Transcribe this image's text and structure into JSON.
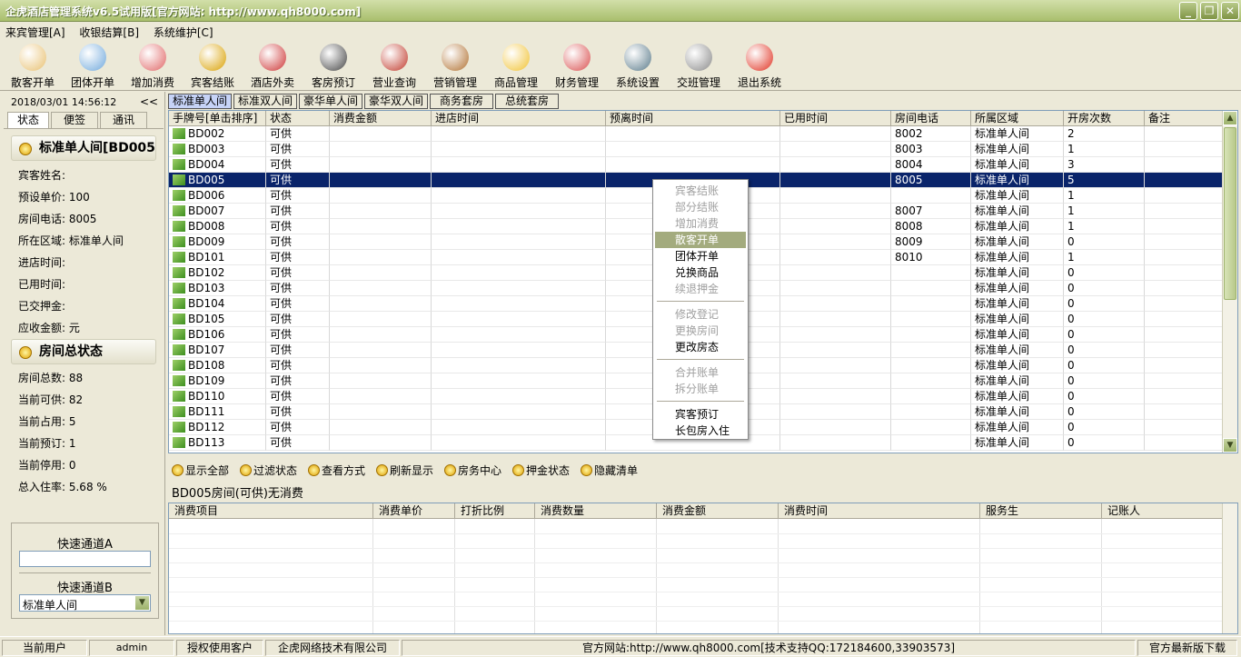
{
  "window": {
    "title": "企虎酒店管理系统v6.5试用版[官方网站: http://www.qh8000.com]"
  },
  "menu": [
    "来宾管理[A]",
    "收银结算[B]",
    "系统维护[C]"
  ],
  "toolbar": [
    {
      "label": "散客开单",
      "color": "#e8c070"
    },
    {
      "label": "团体开单",
      "color": "#6fa8dc"
    },
    {
      "label": "增加消费",
      "color": "#e06666"
    },
    {
      "label": "宾客结账",
      "color": "#d9a000"
    },
    {
      "label": "酒店外卖",
      "color": "#cc3333"
    },
    {
      "label": "客房预订",
      "color": "#444444"
    },
    {
      "label": "营业查询",
      "color": "#c0392b"
    },
    {
      "label": "营销管理",
      "color": "#b07030"
    },
    {
      "label": "商品管理",
      "color": "#f1c232"
    },
    {
      "label": "财务管理",
      "color": "#d94f4f"
    },
    {
      "label": "系统设置",
      "color": "#5a7a8a"
    },
    {
      "label": "交班管理",
      "color": "#8a8a8a"
    },
    {
      "label": "退出系统",
      "color": "#e03020"
    }
  ],
  "left": {
    "datetime": "2018/03/01 14:56:12",
    "collapse": "<<",
    "tabs": [
      "状态",
      "便签",
      "通讯"
    ],
    "room_title": "标准单人间[BD005",
    "fields": [
      "宾客姓名:",
      "预设单价: 100",
      "房间电话: 8005",
      "所在区域: 标准单人间",
      "进店时间:",
      "已用时间:",
      "已交押金:",
      "应收金额: 元"
    ],
    "status_title": "房间总状态",
    "stats": [
      "房间总数: 88",
      "当前可供: 82",
      "当前占用: 5",
      "当前预订: 1",
      "当前停用: 0",
      "总入住率: 5.68 %"
    ],
    "quick_a": "快速通道A",
    "quick_b": "快速通道B",
    "quick_b_value": "标准单人间"
  },
  "room_tabs": [
    "标准单人间",
    "标准双人间",
    "豪华单人间",
    "豪华双人间",
    "商务套房",
    "总统套房"
  ],
  "grid": {
    "headers": [
      "手牌号[单击排序]",
      "状态",
      "消费金额",
      "进店时间",
      "预离时间",
      "已用时间",
      "房间电话",
      "所属区域",
      "开房次数",
      "备注"
    ],
    "rows": [
      [
        "BD002",
        "可供",
        "",
        "",
        "",
        "",
        "8002",
        "标准单人间",
        "2",
        ""
      ],
      [
        "BD003",
        "可供",
        "",
        "",
        "",
        "",
        "8003",
        "标准单人间",
        "1",
        ""
      ],
      [
        "BD004",
        "可供",
        "",
        "",
        "",
        "",
        "8004",
        "标准单人间",
        "3",
        ""
      ],
      [
        "BD005",
        "可供",
        "",
        "",
        "",
        "",
        "8005",
        "标准单人间",
        "5",
        ""
      ],
      [
        "BD006",
        "可供",
        "",
        "",
        "",
        "",
        "",
        "标准单人间",
        "1",
        ""
      ],
      [
        "BD007",
        "可供",
        "",
        "",
        "",
        "",
        "8007",
        "标准单人间",
        "1",
        ""
      ],
      [
        "BD008",
        "可供",
        "",
        "",
        "",
        "",
        "8008",
        "标准单人间",
        "1",
        ""
      ],
      [
        "BD009",
        "可供",
        "",
        "",
        "",
        "",
        "8009",
        "标准单人间",
        "0",
        ""
      ],
      [
        "BD101",
        "可供",
        "",
        "",
        "",
        "",
        "8010",
        "标准单人间",
        "1",
        ""
      ],
      [
        "BD102",
        "可供",
        "",
        "",
        "",
        "",
        "",
        "标准单人间",
        "0",
        ""
      ],
      [
        "BD103",
        "可供",
        "",
        "",
        "",
        "",
        "",
        "标准单人间",
        "0",
        ""
      ],
      [
        "BD104",
        "可供",
        "",
        "",
        "",
        "",
        "",
        "标准单人间",
        "0",
        ""
      ],
      [
        "BD105",
        "可供",
        "",
        "",
        "",
        "",
        "",
        "标准单人间",
        "0",
        ""
      ],
      [
        "BD106",
        "可供",
        "",
        "",
        "",
        "",
        "",
        "标准单人间",
        "0",
        ""
      ],
      [
        "BD107",
        "可供",
        "",
        "",
        "",
        "",
        "",
        "标准单人间",
        "0",
        ""
      ],
      [
        "BD108",
        "可供",
        "",
        "",
        "",
        "",
        "",
        "标准单人间",
        "0",
        ""
      ],
      [
        "BD109",
        "可供",
        "",
        "",
        "",
        "",
        "",
        "标准单人间",
        "0",
        ""
      ],
      [
        "BD110",
        "可供",
        "",
        "",
        "",
        "",
        "",
        "标准单人间",
        "0",
        ""
      ],
      [
        "BD111",
        "可供",
        "",
        "",
        "",
        "",
        "",
        "标准单人间",
        "0",
        ""
      ],
      [
        "BD112",
        "可供",
        "",
        "",
        "",
        "",
        "",
        "标准单人间",
        "0",
        ""
      ],
      [
        "BD113",
        "可供",
        "",
        "",
        "",
        "",
        "",
        "标准单人间",
        "0",
        ""
      ]
    ],
    "selected_index": 3
  },
  "context_menu": [
    {
      "label": "宾客结账",
      "disabled": true
    },
    {
      "label": "部分结账",
      "disabled": true
    },
    {
      "label": "增加消费",
      "disabled": true
    },
    {
      "label": "散客开单",
      "disabled": false,
      "highlight": true
    },
    {
      "label": "团体开单",
      "disabled": false
    },
    {
      "label": "兑换商品",
      "disabled": false
    },
    {
      "label": "续退押金",
      "disabled": true
    },
    {
      "sep": true
    },
    {
      "label": "修改登记",
      "disabled": true
    },
    {
      "label": "更换房间",
      "disabled": true
    },
    {
      "label": "更改房态",
      "disabled": false
    },
    {
      "sep": true
    },
    {
      "label": "合并账单",
      "disabled": true
    },
    {
      "label": "拆分账单",
      "disabled": true
    },
    {
      "sep": true
    },
    {
      "label": "宾客预订",
      "disabled": false
    },
    {
      "label": "长包房入住",
      "disabled": false
    }
  ],
  "actions": [
    "显示全部",
    "过滤状态",
    "查看方式",
    "刷新显示",
    "房务中心",
    "押金状态",
    "隐藏清单"
  ],
  "info_line": "BD005房间(可供)无消费",
  "detail_headers": [
    "消费项目",
    "消费单价",
    "打折比例",
    "消费数量",
    "消费金额",
    "消费时间",
    "服务生",
    "记账人"
  ],
  "status_bar": [
    "当前用户",
    "admin",
    "授权使用客户",
    "企虎网络技术有限公司",
    "官方网站:http://www.qh8000.com[技术支持QQ:172184600,33903573]",
    "官方最新版下载"
  ]
}
